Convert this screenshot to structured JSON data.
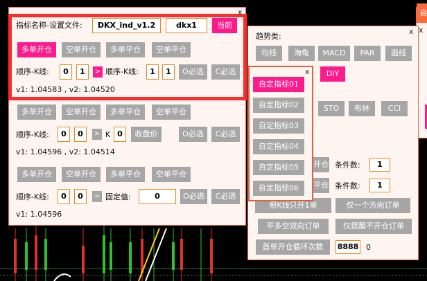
{
  "panel_main": {
    "close": "x",
    "title_label": "指标名称-设置文件:",
    "indicator_name": "DKX_ind_v1.2",
    "settings_file": "dkx1",
    "current_btn": "当前",
    "sections": [
      {
        "buttons": [
          "多单开仓",
          "空单开仓",
          "多单平仓",
          "空单平仓"
        ],
        "seq_label": "顺序-K线:",
        "v_a": "0",
        "v_b": "1",
        "arrow": ">",
        "seq_label2": "顺序-K线:",
        "v_c": "1",
        "v_d": "1",
        "o_btn": "O必选",
        "c_btn": "C必选",
        "values": "v1: 1.04583 , v2: 1.04520"
      },
      {
        "buttons": [
          "多单开仓",
          "空单开仓",
          "多单平仓",
          "空单平仓"
        ],
        "seq_label": "顺序-K线:",
        "v_a": "0",
        "v_b": "0",
        "arrow": ">",
        "k_label": "K",
        "v_k": "0",
        "close_price_btn": "收盘价",
        "o_btn": "O必选",
        "c_btn": "C必选",
        "values": "v1: 1.04596 , v2: 1.04514"
      },
      {
        "buttons": [
          "多单开仓",
          "空单开仓",
          "多单平仓",
          "空单平仓"
        ],
        "seq_label": "顺序-K线:",
        "v_a": "0",
        "v_b": "0",
        "arrow": ">",
        "fixed_label": "固定值:",
        "fixed_value": "0",
        "o_btn": "O必选",
        "c_btn": "C必选",
        "values": "v1: 1.04596"
      }
    ]
  },
  "panel_trend": {
    "close": "x",
    "title": "趋势类:",
    "row1": [
      "均线",
      "海龟",
      "MACD",
      "PAR",
      "画线"
    ],
    "diy": "DIY",
    "row2": [
      "STO",
      "布林",
      "CCI"
    ],
    "cond_label": "条件数:",
    "cond1": "1",
    "cond2": "1",
    "partial1": "开仓",
    "partial2": "平仓",
    "partial3": "根K线只开1单",
    "one_dir": "仅一个方向订单",
    "bidir": "平多空双向订单",
    "remind": "仅提醒不开仓订单",
    "loop_label": "首单开仓循环次数",
    "loop_value": "8888",
    "loop_count": "0"
  },
  "panel_custom": {
    "close": "x",
    "items": [
      "自定指标01",
      "自定指标02",
      "自定指标03",
      "自定指标04",
      "自定指标05",
      "自定指标06"
    ]
  },
  "panel_right": {
    "close": "x",
    "partial": "自"
  },
  "colors": {
    "accent": "#ff1a8c",
    "button_gray": "#a6a6a6",
    "panel_bg": "#fff5f0",
    "highlight": "#ff2a2a",
    "box_border": "#e08a20"
  }
}
